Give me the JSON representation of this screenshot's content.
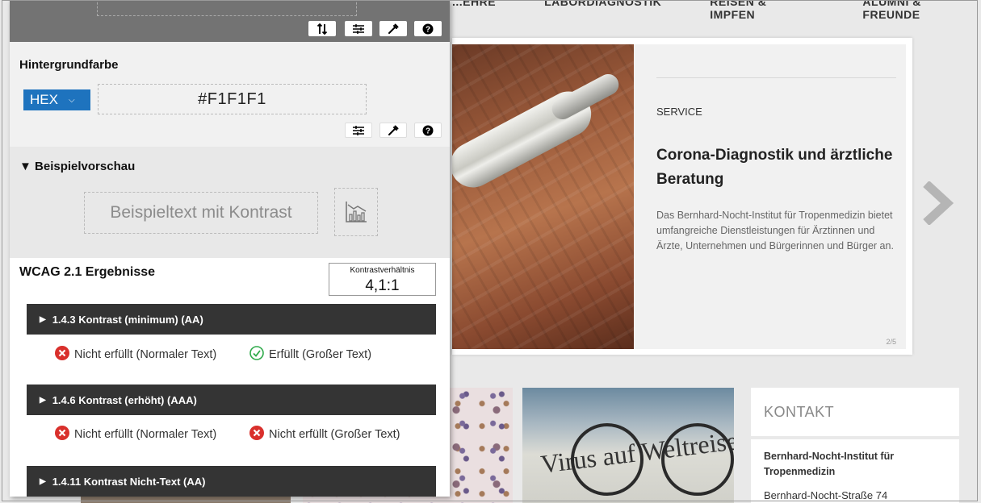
{
  "website": {
    "nav": [
      "...EHRE",
      "LABORDIAGNOSTIK",
      "REISEN & IMPFEN",
      "ALUMNI & FREUNDE"
    ],
    "slide": {
      "eyebrow": "SERVICE",
      "title": "Corona-Diagnostik und ärztliche Beratung",
      "description": "Das Bernhard-Nocht-Institut für Tropenmedizin bietet umfangreiche Dienstleistungen für Ärztinnen und Ärzte, Unternehmen und Bürgerinnen und Bürger an.",
      "counter": "2/5"
    },
    "news_image_text": "Virus auf Weltreise",
    "kontakt": {
      "title": "KONTAKT",
      "institute": "Bernhard-Nocht-Institut für Tropenmedizin",
      "street": "Bernhard-Nocht-Straße 74"
    }
  },
  "panel": {
    "toolbar_icons": [
      "swap-icon",
      "sliders-icon",
      "eyedropper-icon",
      "help-icon"
    ],
    "background": {
      "label": "Hintergrundfarbe",
      "format": "HEX",
      "value": "#F1F1F1"
    },
    "preview": {
      "heading": "Beispielvorschau",
      "sample_text": "Beispieltext mit Kontrast"
    },
    "results": {
      "title": "WCAG 2.1 Ergebnisse",
      "ratio_label": "Kontrastverhältnis",
      "ratio_value": "4,1:1",
      "criteria": [
        {
          "label": "1.4.3 Kontrast (minimum) (AA)",
          "normal": {
            "status": "fail",
            "text": "Nicht erfüllt (Normaler Text)"
          },
          "large": {
            "status": "pass",
            "text": "Erfüllt (Großer Text)"
          }
        },
        {
          "label": "1.4.6 Kontrast (erhöht) (AAA)",
          "normal": {
            "status": "fail",
            "text": "Nicht erfüllt (Normaler Text)"
          },
          "large": {
            "status": "fail",
            "text": "Nicht erfüllt (Großer Text)"
          }
        },
        {
          "label": "1.4.11 Kontrast Nicht-Text (AA)"
        }
      ]
    }
  },
  "colors": {
    "accent": "#1e73be",
    "fail": "#d9302c",
    "pass": "#2eaa4a",
    "criteria_bar": "#343434"
  }
}
